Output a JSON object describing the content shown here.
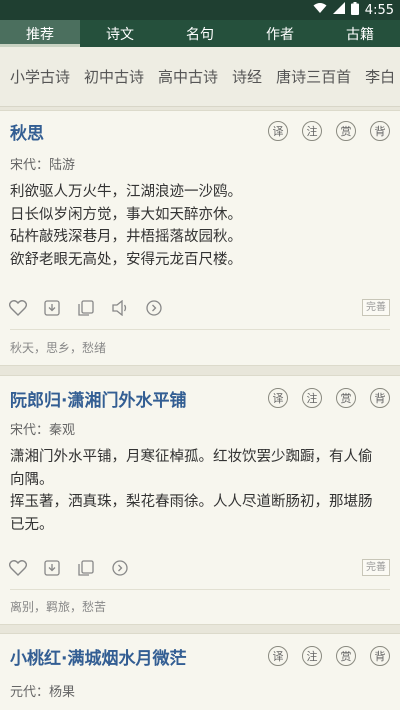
{
  "status": {
    "time": "4:55"
  },
  "tabs": [
    {
      "label": "推荐",
      "active": true
    },
    {
      "label": "诗文",
      "active": false
    },
    {
      "label": "名句",
      "active": false
    },
    {
      "label": "作者",
      "active": false
    },
    {
      "label": "古籍",
      "active": false
    }
  ],
  "categories": [
    "小学古诗",
    "初中古诗",
    "高中古诗",
    "诗经",
    "唐诗三百首",
    "李白"
  ],
  "action_labels": {
    "yi": "译",
    "zhu": "注",
    "shang": "赏",
    "bei": "背"
  },
  "complete_label": "完善",
  "poems": [
    {
      "title": "秋思",
      "author": "宋代：陆游",
      "lines": [
        "利欲驱人万火牛，江湖浪迹一沙鸥。",
        "日长似岁闲方觉，事大如天醉亦休。",
        "砧杵敲残深巷月，井梧摇落故园秋。",
        "欲舒老眼无高处，安得元龙百尺楼。"
      ],
      "tags": "秋天，思乡，愁绪"
    },
    {
      "title": "阮郎归·潇湘门外水平铺",
      "author": "宋代：秦观",
      "lines": [
        "潇湘门外水平铺，月寒征棹孤。红妆饮罢少踟蹰，有人偷",
        "向隅。",
        "挥玉著，洒真珠，梨花春雨徐。人人尽道断肠初，那堪肠",
        "已无。"
      ],
      "tags": "离别，羁旅，愁苦"
    },
    {
      "title": "小桃红·满城烟水月微茫",
      "author": "元代：杨果",
      "lines": [],
      "tags": ""
    }
  ]
}
